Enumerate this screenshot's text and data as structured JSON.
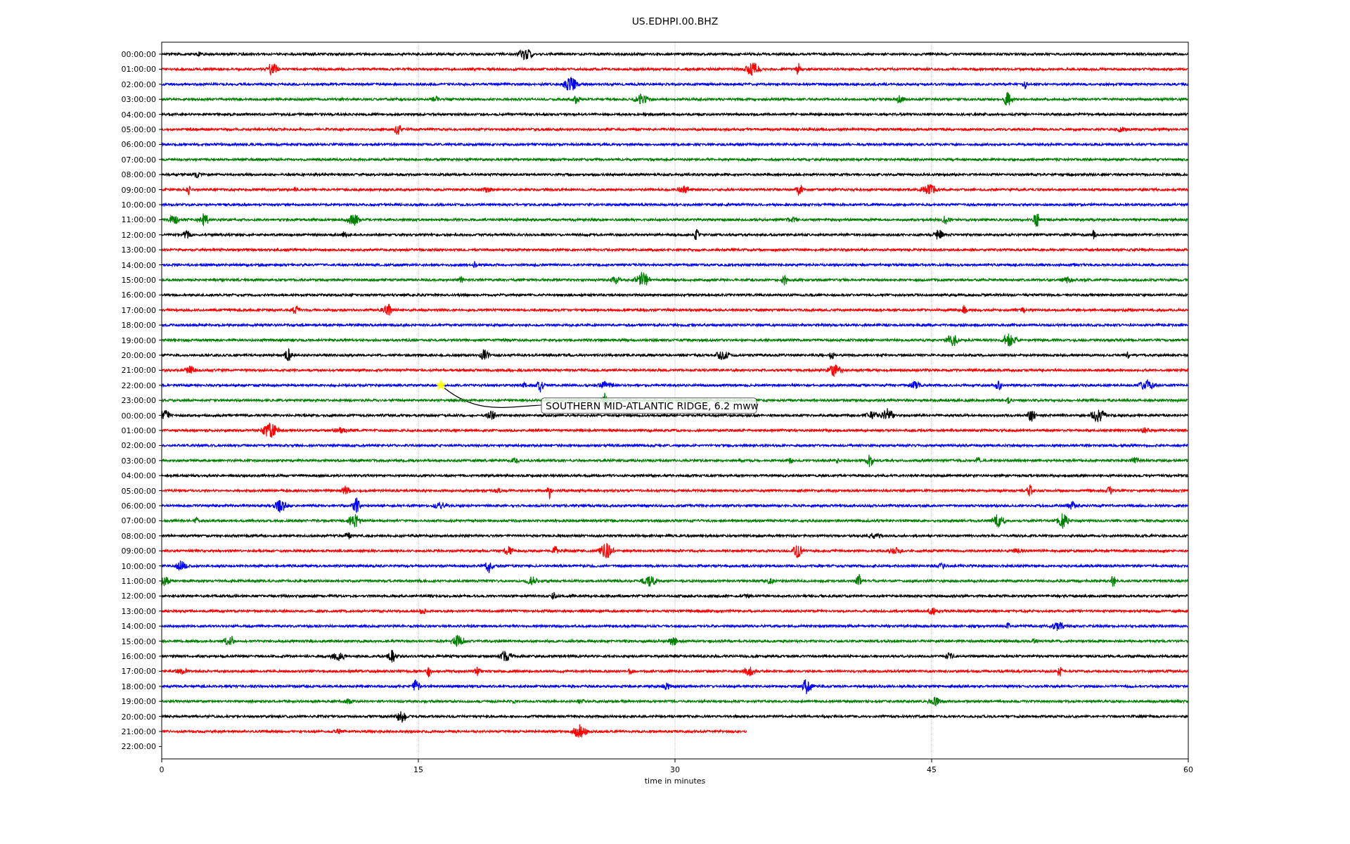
{
  "title": "US.EDHPI.00.BHZ",
  "rows": [
    {
      "label": "00:00:00",
      "color": "#000000",
      "level": 1,
      "event": false
    },
    {
      "label": "01:00:00",
      "color": "#ff0000",
      "level": 1,
      "event": false
    },
    {
      "label": "02:00:00",
      "color": "#0000ff",
      "level": 1,
      "event": false
    },
    {
      "label": "03:00:00",
      "color": "#008000",
      "level": 1,
      "event": false
    },
    {
      "label": "04:00:00",
      "color": "#000000",
      "level": 1,
      "event": false
    },
    {
      "label": "05:00:00",
      "color": "#ff0000",
      "level": 1,
      "event": false
    },
    {
      "label": "06:00:00",
      "color": "#0000ff",
      "level": 1,
      "event": false
    },
    {
      "label": "07:00:00",
      "color": "#008000",
      "level": 1,
      "event": false
    },
    {
      "label": "08:00:00",
      "color": "#000000",
      "level": 1,
      "event": false
    },
    {
      "label": "09:00:00",
      "color": "#ff0000",
      "level": 1,
      "event": false
    },
    {
      "label": "10:00:00",
      "color": "#0000ff",
      "level": 1,
      "event": false
    },
    {
      "label": "11:00:00",
      "color": "#008000",
      "level": 1,
      "event": false
    },
    {
      "label": "12:00:00",
      "color": "#000000",
      "level": 1,
      "event": false
    },
    {
      "label": "13:00:00",
      "color": "#ff0000",
      "level": 1,
      "event": false
    },
    {
      "label": "14:00:00",
      "color": "#0000ff",
      "level": 1,
      "event": false
    },
    {
      "label": "15:00:00",
      "color": "#008000",
      "level": 1,
      "event": false
    },
    {
      "label": "16:00:00",
      "color": "#000000",
      "level": 1,
      "event": false
    },
    {
      "label": "17:00:00",
      "color": "#ff0000",
      "level": 1,
      "event": false
    },
    {
      "label": "18:00:00",
      "color": "#0000ff",
      "level": 1,
      "event": false
    },
    {
      "label": "19:00:00",
      "color": "#008000",
      "level": 1,
      "event": false
    },
    {
      "label": "20:00:00",
      "color": "#000000",
      "level": 1,
      "event": false
    },
    {
      "label": "21:00:00",
      "color": "#ff0000",
      "level": 1,
      "event": false
    },
    {
      "label": "22:00:00",
      "color": "#0000ff",
      "level": 1,
      "event": true
    },
    {
      "label": "23:00:00",
      "color": "#008000",
      "level": 1,
      "event": false
    },
    {
      "label": "00:00:00",
      "color": "#000000",
      "level": 1,
      "event": false
    },
    {
      "label": "01:00:00",
      "color": "#ff0000",
      "level": 1,
      "event": false
    },
    {
      "label": "02:00:00",
      "color": "#0000ff",
      "level": 1,
      "event": false
    },
    {
      "label": "03:00:00",
      "color": "#008000",
      "level": 1,
      "event": false
    },
    {
      "label": "04:00:00",
      "color": "#000000",
      "level": 1,
      "event": false
    },
    {
      "label": "05:00:00",
      "color": "#ff0000",
      "level": 1,
      "event": false
    },
    {
      "label": "06:00:00",
      "color": "#0000ff",
      "level": 1,
      "event": false
    },
    {
      "label": "07:00:00",
      "color": "#008000",
      "level": 1,
      "event": false
    },
    {
      "label": "08:00:00",
      "color": "#000000",
      "level": 1,
      "event": false
    },
    {
      "label": "09:00:00",
      "color": "#ff0000",
      "level": 1,
      "event": false
    },
    {
      "label": "10:00:00",
      "color": "#0000ff",
      "level": 1,
      "event": false
    },
    {
      "label": "11:00:00",
      "color": "#008000",
      "level": 1,
      "event": false
    },
    {
      "label": "12:00:00",
      "color": "#000000",
      "level": 1,
      "event": false
    },
    {
      "label": "13:00:00",
      "color": "#ff0000",
      "level": 1,
      "event": false
    },
    {
      "label": "14:00:00",
      "color": "#0000ff",
      "level": 1,
      "event": false
    },
    {
      "label": "15:00:00",
      "color": "#008000",
      "level": 1,
      "event": false
    },
    {
      "label": "16:00:00",
      "color": "#000000",
      "level": 1,
      "event": false
    },
    {
      "label": "17:00:00",
      "color": "#ff0000",
      "level": 1,
      "event": false
    },
    {
      "label": "18:00:00",
      "color": "#0000ff",
      "level": 1,
      "event": false
    },
    {
      "label": "19:00:00",
      "color": "#008000",
      "level": 1,
      "event": false
    },
    {
      "label": "20:00:00",
      "color": "#000000",
      "level": 1,
      "event": false
    },
    {
      "label": "21:00:00",
      "color": "#ff0000",
      "level": 0.57,
      "event": false
    },
    {
      "label": "22:00:00",
      "event": false
    }
  ],
  "xticks": [
    "0",
    "15",
    "30",
    "45",
    "60"
  ],
  "xlabel": "time in minutes",
  "annotation": "SOUTHERN MID-ATLANTIC RIDGE, 6.2 mww"
}
